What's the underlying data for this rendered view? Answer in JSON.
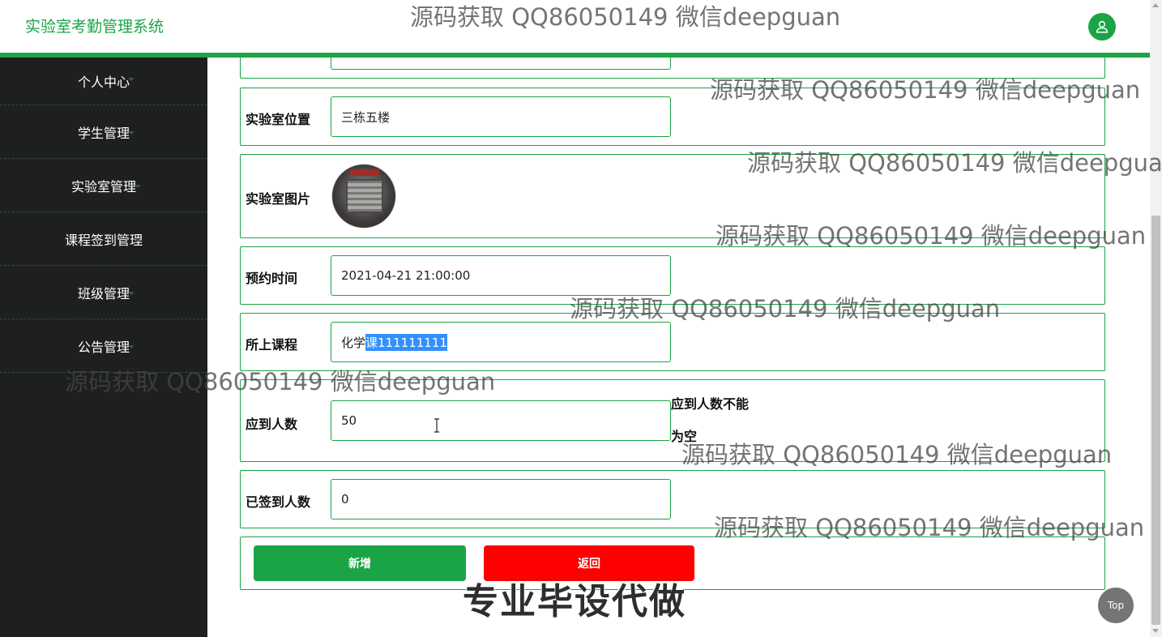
{
  "header": {
    "app_title": "实验室考勤管理系统",
    "avatar_icon": "user-icon",
    "accent_color": "#1aa446"
  },
  "sidebar": {
    "items": [
      {
        "label": "个人中心"
      },
      {
        "label": "学生管理"
      },
      {
        "label": "实验室管理"
      },
      {
        "label": "课程签到管理"
      },
      {
        "label": "班级管理"
      },
      {
        "label": "公告管理"
      }
    ]
  },
  "form": {
    "location": {
      "label": "实验室位置",
      "value": "三栋五楼"
    },
    "image": {
      "label": "实验室图片"
    },
    "reserve_time": {
      "label": "预约时间",
      "value": "2021-04-21 21:00:00"
    },
    "course": {
      "label": "所上课程",
      "value_prefix": "化学",
      "value_selected": "课111111111"
    },
    "expected": {
      "label": "应到人数",
      "value": "50",
      "error_line1": "应到人数不能",
      "error_line2": "为空"
    },
    "signed": {
      "label": "已签到人数",
      "value": "0"
    },
    "add_button": "新增",
    "back_button": "返回"
  },
  "top_button": "Top",
  "watermarks": {
    "repeated": "源码获取 QQ86050149 微信deepguan",
    "big": "专业毕设代做"
  }
}
